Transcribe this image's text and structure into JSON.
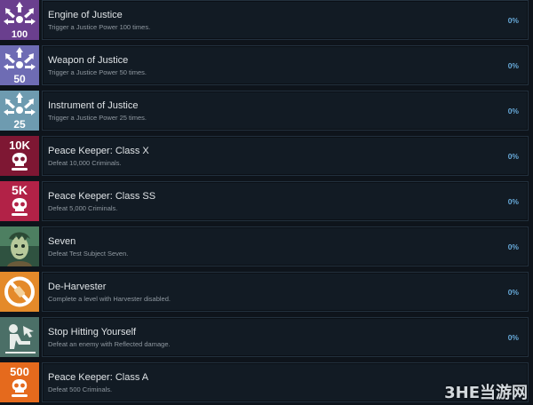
{
  "achievements": [
    {
      "title": "Engine of Justice",
      "description": "Trigger a Justice Power 100 times.",
      "percent": "0%",
      "icon": "justice-icon",
      "icon_label": "100",
      "icon_bg": "#6a3f8e"
    },
    {
      "title": "Weapon of Justice",
      "description": "Trigger a Justice Power 50 times.",
      "percent": "0%",
      "icon": "justice-icon",
      "icon_label": "50",
      "icon_bg": "#6e6cb4"
    },
    {
      "title": "Instrument of Justice",
      "description": "Trigger a Justice Power 25 times.",
      "percent": "0%",
      "icon": "justice-icon",
      "icon_label": "25",
      "icon_bg": "#6e9bb0"
    },
    {
      "title": "Peace Keeper: Class X",
      "description": "Defeat 10,000 Criminals.",
      "percent": "0%",
      "icon": "skull-icon",
      "icon_label": "10K",
      "icon_bg": "#7e1733"
    },
    {
      "title": "Peace Keeper: Class SS",
      "description": "Defeat 5,000 Criminals.",
      "percent": "0%",
      "icon": "skull-icon",
      "icon_label": "5K",
      "icon_bg": "#b22247"
    },
    {
      "title": "Seven",
      "description": "Defeat Test Subject Seven.",
      "percent": "0%",
      "icon": "face-icon",
      "icon_label": "",
      "icon_bg": "#3f6b4e"
    },
    {
      "title": "De-Harvester",
      "description": "Complete a level with Harvester disabled.",
      "percent": "0%",
      "icon": "no-harvester-icon",
      "icon_label": "",
      "icon_bg": "#e48a2a"
    },
    {
      "title": "Stop Hitting Yourself",
      "description": "Defeat an enemy with Reflected damage.",
      "percent": "0%",
      "icon": "reflect-icon",
      "icon_label": "",
      "icon_bg": "#4b6f67"
    },
    {
      "title": "Peace Keeper: Class A",
      "description": "Defeat 500 Criminals.",
      "percent": "",
      "icon": "skull-icon",
      "icon_label": "500",
      "icon_bg": "#e56a1d"
    }
  ],
  "watermark": {
    "text": "3HE当游网"
  }
}
